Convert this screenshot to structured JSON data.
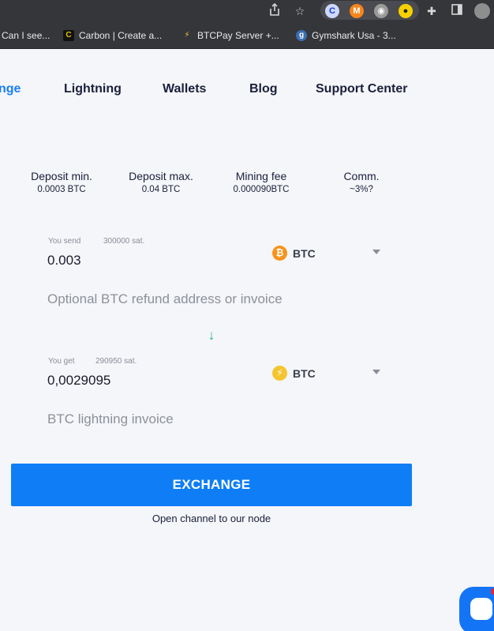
{
  "browser": {
    "bookmarks": [
      {
        "label": "Can I see..."
      },
      {
        "label": "Carbon | Create a..."
      },
      {
        "label": "BTCPay Server +..."
      },
      {
        "label": "Gymshark Usa - 3..."
      }
    ],
    "icons": [
      "share-icon",
      "star-icon",
      "extension-1-icon",
      "metamask-icon",
      "camera-icon",
      "bee-icon",
      "puzzle-icon",
      "sidepanel-icon",
      "profile-avatar"
    ]
  },
  "nav": {
    "items": [
      {
        "label": "nge"
      },
      {
        "label": "Lightning"
      },
      {
        "label": "Wallets"
      },
      {
        "label": "Blog"
      },
      {
        "label": "Support Center"
      }
    ]
  },
  "stats": [
    {
      "label": "Deposit min.",
      "value": "0.0003 BTC"
    },
    {
      "label": "Deposit max.",
      "value": "0.04 BTC"
    },
    {
      "label": "Mining fee",
      "value": "0.000090BTC"
    },
    {
      "label": "Comm.",
      "value": "~3%?"
    }
  ],
  "send": {
    "label": "You send",
    "sats": "300000 sat.",
    "amount": "0.003",
    "currency": "BTC",
    "refund_placeholder": "Optional BTC refund address or invoice"
  },
  "receive": {
    "label": "You get",
    "sats": "290950 sat.",
    "amount": "0,0029095",
    "currency": "BTC",
    "invoice_placeholder": "BTC lightning invoice"
  },
  "exchange_button": "EXCHANGE",
  "channel_note": "Open channel to our node",
  "colors": {
    "accent": "#0f7ef6",
    "bitcoin": "#f7931a",
    "lightning": "#f5c531",
    "arrow": "#22b573"
  }
}
